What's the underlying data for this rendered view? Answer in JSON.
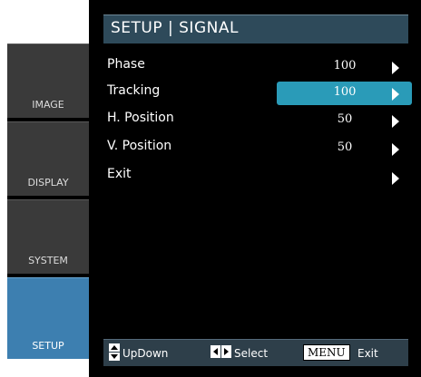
{
  "title": "SETUP | SIGNAL",
  "sidebar": {
    "items": [
      {
        "label": "IMAGE"
      },
      {
        "label": "DISPLAY"
      },
      {
        "label": "SYSTEM"
      },
      {
        "label": "SETUP"
      }
    ]
  },
  "menu": {
    "rows": [
      {
        "name": "Phase",
        "value": "100"
      },
      {
        "name": "Tracking",
        "value": "100"
      },
      {
        "name": "H. Position",
        "value": "50"
      },
      {
        "name": "V. Position",
        "value": "50"
      },
      {
        "name": "Exit",
        "value": ""
      }
    ]
  },
  "footer": {
    "updown_label": "UpDown",
    "select_label": "Select",
    "menu_key": "MENU",
    "exit_label": "Exit"
  },
  "colors": {
    "accent": "#2a9bb8",
    "active_tab": "#3d7fb0",
    "title_bar": "#2e4a5a"
  },
  "icons": [
    "updown-icon",
    "left-right-icon",
    "chevron-right-icon"
  ]
}
